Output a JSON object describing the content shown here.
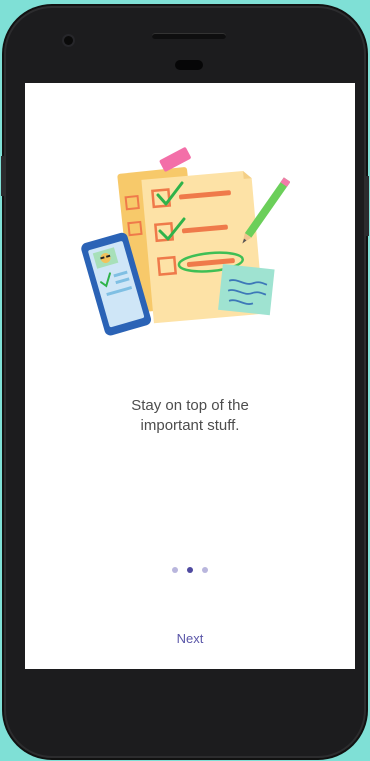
{
  "onboarding": {
    "message_line1": "Stay on top of the",
    "message_line2": "important stuff.",
    "illustration": "checklist-illustration",
    "page_indicator": {
      "total": 3,
      "active_index": 1
    },
    "next_label": "Next"
  },
  "colors": {
    "background": "#7fe0d6",
    "device": "#1c1c1e",
    "screen": "#ffffff",
    "text": "#4d4d4d",
    "accent": "#5a56a8",
    "dot_inactive": "#b9b6dd",
    "dot_active": "#4f4aa0"
  }
}
